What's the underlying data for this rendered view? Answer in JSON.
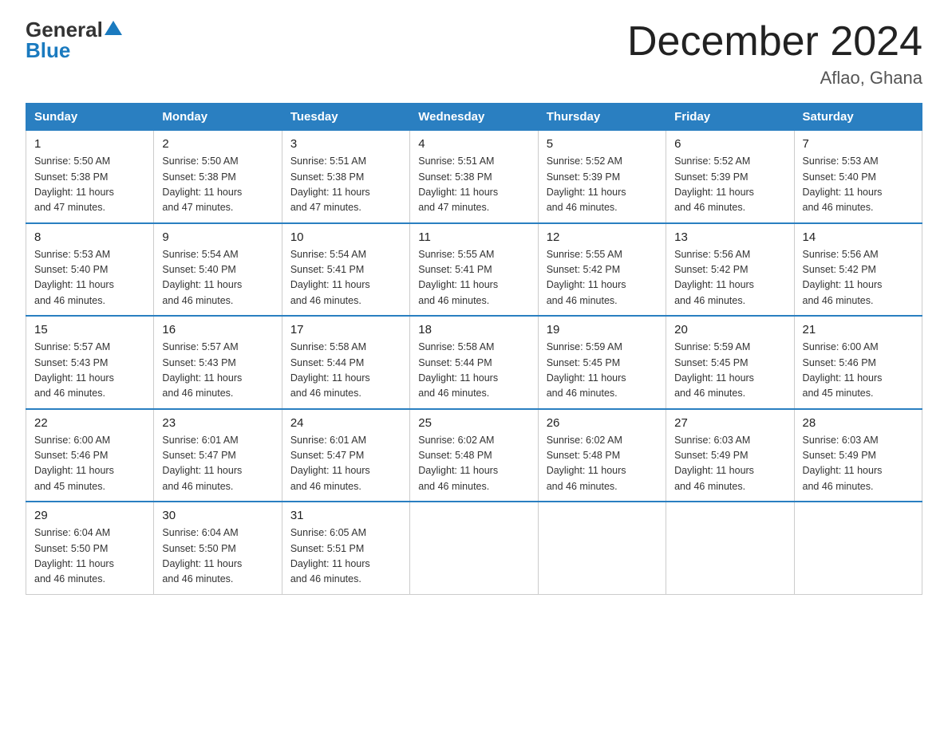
{
  "header": {
    "logo": {
      "general": "General",
      "blue": "Blue"
    },
    "title": "December 2024",
    "location": "Aflao, Ghana"
  },
  "calendar": {
    "days_of_week": [
      "Sunday",
      "Monday",
      "Tuesday",
      "Wednesday",
      "Thursday",
      "Friday",
      "Saturday"
    ],
    "weeks": [
      [
        {
          "day": "1",
          "sunrise": "5:50 AM",
          "sunset": "5:38 PM",
          "daylight": "11 hours and 47 minutes."
        },
        {
          "day": "2",
          "sunrise": "5:50 AM",
          "sunset": "5:38 PM",
          "daylight": "11 hours and 47 minutes."
        },
        {
          "day": "3",
          "sunrise": "5:51 AM",
          "sunset": "5:38 PM",
          "daylight": "11 hours and 47 minutes."
        },
        {
          "day": "4",
          "sunrise": "5:51 AM",
          "sunset": "5:38 PM",
          "daylight": "11 hours and 47 minutes."
        },
        {
          "day": "5",
          "sunrise": "5:52 AM",
          "sunset": "5:39 PM",
          "daylight": "11 hours and 46 minutes."
        },
        {
          "day": "6",
          "sunrise": "5:52 AM",
          "sunset": "5:39 PM",
          "daylight": "11 hours and 46 minutes."
        },
        {
          "day": "7",
          "sunrise": "5:53 AM",
          "sunset": "5:40 PM",
          "daylight": "11 hours and 46 minutes."
        }
      ],
      [
        {
          "day": "8",
          "sunrise": "5:53 AM",
          "sunset": "5:40 PM",
          "daylight": "11 hours and 46 minutes."
        },
        {
          "day": "9",
          "sunrise": "5:54 AM",
          "sunset": "5:40 PM",
          "daylight": "11 hours and 46 minutes."
        },
        {
          "day": "10",
          "sunrise": "5:54 AM",
          "sunset": "5:41 PM",
          "daylight": "11 hours and 46 minutes."
        },
        {
          "day": "11",
          "sunrise": "5:55 AM",
          "sunset": "5:41 PM",
          "daylight": "11 hours and 46 minutes."
        },
        {
          "day": "12",
          "sunrise": "5:55 AM",
          "sunset": "5:42 PM",
          "daylight": "11 hours and 46 minutes."
        },
        {
          "day": "13",
          "sunrise": "5:56 AM",
          "sunset": "5:42 PM",
          "daylight": "11 hours and 46 minutes."
        },
        {
          "day": "14",
          "sunrise": "5:56 AM",
          "sunset": "5:42 PM",
          "daylight": "11 hours and 46 minutes."
        }
      ],
      [
        {
          "day": "15",
          "sunrise": "5:57 AM",
          "sunset": "5:43 PM",
          "daylight": "11 hours and 46 minutes."
        },
        {
          "day": "16",
          "sunrise": "5:57 AM",
          "sunset": "5:43 PM",
          "daylight": "11 hours and 46 minutes."
        },
        {
          "day": "17",
          "sunrise": "5:58 AM",
          "sunset": "5:44 PM",
          "daylight": "11 hours and 46 minutes."
        },
        {
          "day": "18",
          "sunrise": "5:58 AM",
          "sunset": "5:44 PM",
          "daylight": "11 hours and 46 minutes."
        },
        {
          "day": "19",
          "sunrise": "5:59 AM",
          "sunset": "5:45 PM",
          "daylight": "11 hours and 46 minutes."
        },
        {
          "day": "20",
          "sunrise": "5:59 AM",
          "sunset": "5:45 PM",
          "daylight": "11 hours and 46 minutes."
        },
        {
          "day": "21",
          "sunrise": "6:00 AM",
          "sunset": "5:46 PM",
          "daylight": "11 hours and 45 minutes."
        }
      ],
      [
        {
          "day": "22",
          "sunrise": "6:00 AM",
          "sunset": "5:46 PM",
          "daylight": "11 hours and 45 minutes."
        },
        {
          "day": "23",
          "sunrise": "6:01 AM",
          "sunset": "5:47 PM",
          "daylight": "11 hours and 46 minutes."
        },
        {
          "day": "24",
          "sunrise": "6:01 AM",
          "sunset": "5:47 PM",
          "daylight": "11 hours and 46 minutes."
        },
        {
          "day": "25",
          "sunrise": "6:02 AM",
          "sunset": "5:48 PM",
          "daylight": "11 hours and 46 minutes."
        },
        {
          "day": "26",
          "sunrise": "6:02 AM",
          "sunset": "5:48 PM",
          "daylight": "11 hours and 46 minutes."
        },
        {
          "day": "27",
          "sunrise": "6:03 AM",
          "sunset": "5:49 PM",
          "daylight": "11 hours and 46 minutes."
        },
        {
          "day": "28",
          "sunrise": "6:03 AM",
          "sunset": "5:49 PM",
          "daylight": "11 hours and 46 minutes."
        }
      ],
      [
        {
          "day": "29",
          "sunrise": "6:04 AM",
          "sunset": "5:50 PM",
          "daylight": "11 hours and 46 minutes."
        },
        {
          "day": "30",
          "sunrise": "6:04 AM",
          "sunset": "5:50 PM",
          "daylight": "11 hours and 46 minutes."
        },
        {
          "day": "31",
          "sunrise": "6:05 AM",
          "sunset": "5:51 PM",
          "daylight": "11 hours and 46 minutes."
        },
        null,
        null,
        null,
        null
      ]
    ]
  }
}
